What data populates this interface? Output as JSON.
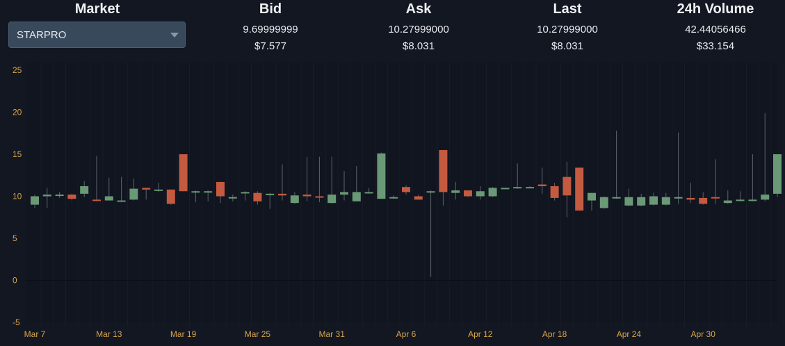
{
  "header": {
    "market_label": "Market",
    "selected_market": "STARPRO",
    "columns": [
      {
        "label": "Bid",
        "value": "9.69999999",
        "usd": "$7.577"
      },
      {
        "label": "Ask",
        "value": "10.27999000",
        "usd": "$8.031"
      },
      {
        "label": "Last",
        "value": "10.27999000",
        "usd": "$8.031"
      },
      {
        "label": "24h Volume",
        "value": "42.44056466",
        "usd": "$33.154"
      }
    ]
  },
  "chart_data": {
    "type": "candlestick",
    "ylim": [
      -5,
      25
    ],
    "yticks": [
      25,
      20,
      15,
      10,
      5,
      0,
      -5
    ],
    "x_tick_labels": [
      "Mar 7",
      "Mar 13",
      "Mar 19",
      "Mar 25",
      "Mar 31",
      "Apr 6",
      "Apr 12",
      "Apr 18",
      "Apr 24",
      "Apr 30"
    ],
    "up_color": "#6a9a75",
    "down_color": "#c45a3f",
    "candles": [
      {
        "date": "Mar 7",
        "open": 9.0,
        "high": 10.2,
        "low": 8.6,
        "close": 10.0
      },
      {
        "date": "Mar 8",
        "open": 10.0,
        "high": 11.0,
        "low": 8.6,
        "close": 10.2
      },
      {
        "date": "Mar 9",
        "open": 10.2,
        "high": 10.5,
        "low": 9.8,
        "close": 10.2
      },
      {
        "date": "Mar 10",
        "open": 10.2,
        "high": 10.3,
        "low": 9.5,
        "close": 9.7
      },
      {
        "date": "Mar 11",
        "open": 10.3,
        "high": 11.8,
        "low": 9.9,
        "close": 11.2
      },
      {
        "date": "Mar 12",
        "open": 9.6,
        "high": 14.8,
        "low": 9.4,
        "close": 9.5
      },
      {
        "date": "Mar 13",
        "open": 9.5,
        "high": 12.2,
        "low": 9.5,
        "close": 10.0
      },
      {
        "date": "Mar 14",
        "open": 9.5,
        "high": 12.3,
        "low": 9.4,
        "close": 9.5
      },
      {
        "date": "Mar 15",
        "open": 9.6,
        "high": 12.1,
        "low": 9.5,
        "close": 10.9
      },
      {
        "date": "Mar 16",
        "open": 11.0,
        "high": 11.0,
        "low": 9.6,
        "close": 10.8
      },
      {
        "date": "Mar 17",
        "open": 10.8,
        "high": 11.6,
        "low": 10.5,
        "close": 10.8
      },
      {
        "date": "Mar 18",
        "open": 10.8,
        "high": 10.8,
        "low": 9.0,
        "close": 9.1
      },
      {
        "date": "Mar 19",
        "open": 15.0,
        "high": 15.0,
        "low": 10.6,
        "close": 10.6
      },
      {
        "date": "Mar 20",
        "open": 10.6,
        "high": 10.7,
        "low": 9.3,
        "close": 10.6
      },
      {
        "date": "Mar 21",
        "open": 10.6,
        "high": 10.7,
        "low": 9.4,
        "close": 10.6
      },
      {
        "date": "Mar 22",
        "open": 11.7,
        "high": 11.7,
        "low": 9.2,
        "close": 10.0
      },
      {
        "date": "Mar 23",
        "open": 9.9,
        "high": 10.2,
        "low": 9.4,
        "close": 9.9
      },
      {
        "date": "Mar 24",
        "open": 10.4,
        "high": 10.6,
        "low": 9.5,
        "close": 10.5
      },
      {
        "date": "Mar 25",
        "open": 10.4,
        "high": 10.6,
        "low": 9.0,
        "close": 9.4
      },
      {
        "date": "Mar 26",
        "open": 10.3,
        "high": 10.4,
        "low": 8.5,
        "close": 10.3
      },
      {
        "date": "Mar 27",
        "open": 10.3,
        "high": 13.8,
        "low": 9.5,
        "close": 10.1
      },
      {
        "date": "Mar 28",
        "open": 9.2,
        "high": 10.5,
        "low": 9.1,
        "close": 10.1
      },
      {
        "date": "Mar 29",
        "open": 10.2,
        "high": 14.7,
        "low": 9.4,
        "close": 10.0
      },
      {
        "date": "Mar 30",
        "open": 10.0,
        "high": 14.7,
        "low": 9.3,
        "close": 9.9
      },
      {
        "date": "Mar 31",
        "open": 9.2,
        "high": 14.7,
        "low": 9.1,
        "close": 10.2
      },
      {
        "date": "Apr 1",
        "open": 10.2,
        "high": 13.0,
        "low": 9.5,
        "close": 10.5
      },
      {
        "date": "Apr 2",
        "open": 9.4,
        "high": 13.6,
        "low": 9.4,
        "close": 10.5
      },
      {
        "date": "Apr 3",
        "open": 10.5,
        "high": 11.0,
        "low": 10.3,
        "close": 10.5
      },
      {
        "date": "Apr 4",
        "open": 9.7,
        "high": 15.2,
        "low": 9.7,
        "close": 15.1
      },
      {
        "date": "Apr 5",
        "open": 9.8,
        "high": 10.1,
        "low": 9.7,
        "close": 9.9
      },
      {
        "date": "Apr 6",
        "open": 11.1,
        "high": 11.3,
        "low": 10.2,
        "close": 10.5
      },
      {
        "date": "Apr 7",
        "open": 10.0,
        "high": 10.2,
        "low": 9.6,
        "close": 9.6
      },
      {
        "date": "Apr 8",
        "open": 10.6,
        "high": 10.7,
        "low": 0.4,
        "close": 10.6
      },
      {
        "date": "Apr 9",
        "open": 15.5,
        "high": 15.5,
        "low": 8.9,
        "close": 10.5
      },
      {
        "date": "Apr 10",
        "open": 10.4,
        "high": 11.7,
        "low": 9.6,
        "close": 10.7
      },
      {
        "date": "Apr 11",
        "open": 10.7,
        "high": 10.7,
        "low": 9.9,
        "close": 10.0
      },
      {
        "date": "Apr 12",
        "open": 10.0,
        "high": 11.2,
        "low": 9.6,
        "close": 10.6
      },
      {
        "date": "Apr 13",
        "open": 10.0,
        "high": 11.1,
        "low": 9.9,
        "close": 11.0
      },
      {
        "date": "Apr 14",
        "open": 11.0,
        "high": 11.0,
        "low": 10.9,
        "close": 11.0
      },
      {
        "date": "Apr 15",
        "open": 11.1,
        "high": 13.9,
        "low": 10.9,
        "close": 11.1
      },
      {
        "date": "Apr 16",
        "open": 11.1,
        "high": 11.2,
        "low": 11.0,
        "close": 11.1
      },
      {
        "date": "Apr 17",
        "open": 11.4,
        "high": 13.4,
        "low": 10.3,
        "close": 11.2
      },
      {
        "date": "Apr 18",
        "open": 11.2,
        "high": 11.6,
        "low": 9.5,
        "close": 9.8
      },
      {
        "date": "Apr 19",
        "open": 12.3,
        "high": 14.1,
        "low": 7.5,
        "close": 10.1
      },
      {
        "date": "Apr 20",
        "open": 13.4,
        "high": 13.4,
        "low": 8.3,
        "close": 8.3
      },
      {
        "date": "Apr 21",
        "open": 9.5,
        "high": 10.4,
        "low": 8.3,
        "close": 10.4
      },
      {
        "date": "Apr 22",
        "open": 8.6,
        "high": 10.0,
        "low": 8.5,
        "close": 9.9
      },
      {
        "date": "Apr 23",
        "open": 9.9,
        "high": 17.8,
        "low": 9.7,
        "close": 9.9
      },
      {
        "date": "Apr 24",
        "open": 8.9,
        "high": 10.9,
        "low": 8.8,
        "close": 9.9
      },
      {
        "date": "Apr 25",
        "open": 8.9,
        "high": 10.3,
        "low": 8.8,
        "close": 9.9
      },
      {
        "date": "Apr 26",
        "open": 9.0,
        "high": 10.4,
        "low": 8.9,
        "close": 10.0
      },
      {
        "date": "Apr 27",
        "open": 9.0,
        "high": 10.4,
        "low": 8.9,
        "close": 9.9
      },
      {
        "date": "Apr 28",
        "open": 9.9,
        "high": 17.6,
        "low": 9.1,
        "close": 9.9
      },
      {
        "date": "Apr 29",
        "open": 9.8,
        "high": 11.6,
        "low": 9.2,
        "close": 9.6
      },
      {
        "date": "Apr 30",
        "open": 9.8,
        "high": 10.5,
        "low": 9.0,
        "close": 9.1
      },
      {
        "date": "May 1",
        "open": 9.9,
        "high": 14.4,
        "low": 9.1,
        "close": 9.8
      },
      {
        "date": "May 2",
        "open": 9.2,
        "high": 10.7,
        "low": 9.1,
        "close": 9.5
      },
      {
        "date": "May 3",
        "open": 9.5,
        "high": 10.6,
        "low": 9.4,
        "close": 9.6
      },
      {
        "date": "May 4",
        "open": 9.5,
        "high": 15.0,
        "low": 9.4,
        "close": 9.6
      },
      {
        "date": "May 5",
        "open": 9.6,
        "high": 19.9,
        "low": 9.4,
        "close": 10.2
      },
      {
        "date": "May 6",
        "open": 10.3,
        "high": 15.0,
        "low": 9.9,
        "close": 15.0
      }
    ]
  }
}
